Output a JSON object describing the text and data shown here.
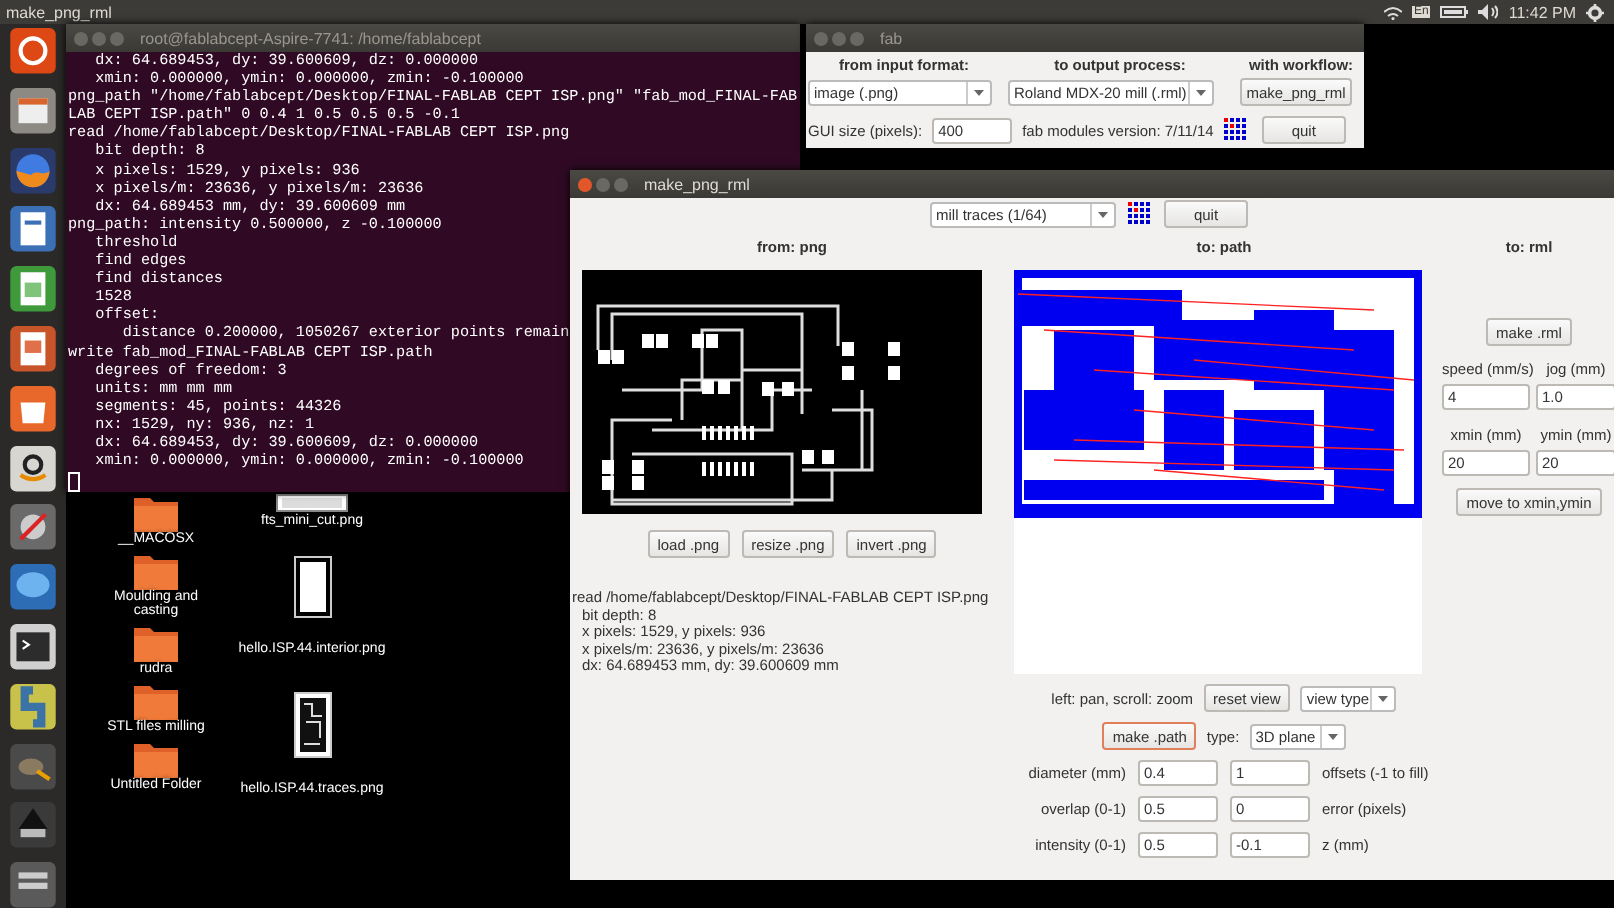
{
  "top_bar": {
    "title": "make_png_rml",
    "keyboard": "En",
    "time": "11:42 PM"
  },
  "terminal": {
    "title": "root@fablabcept-Aspire-7741: /home/fablabcept",
    "lines": [
      "   dx: 64.689453, dy: 39.600609, dz: 0.000000",
      "   xmin: 0.000000, ymin: 0.000000, zmin: -0.100000",
      "png_path \"/home/fablabcept/Desktop/FINAL-FABLAB CEPT ISP.png\" \"fab_mod_FINAL-FAB",
      "LAB CEPT ISP.path\" 0 0.4 1 0.5 0.5 0.5 -0.1",
      "read /home/fablabcept/Desktop/FINAL-FABLAB CEPT ISP.png",
      "   bit depth: 8",
      "   x pixels: 1529, y pixels: 936",
      "   x pixels/m: 23636, y pixels/m: 23636",
      "   dx: 64.689453 mm, dy: 39.600609 mm",
      "png_path: intensity 0.500000, z -0.100000",
      "   threshold",
      "   find edges",
      "   find distances",
      "   1528",
      "   offset:",
      "      distance 0.200000, 1050267 exterior points remain",
      "write fab_mod_FINAL-FABLAB CEPT ISP.path",
      "   degrees of freedom: 3",
      "   units: mm mm mm",
      "   segments: 45, points: 44326",
      "   nx: 1529, ny: 936, nz: 1",
      "   dx: 64.689453, dy: 39.600609, dz: 0.000000",
      "   xmin: 0.000000, ymin: 0.000000, zmin: -0.100000"
    ]
  },
  "desktop": {
    "folders": [
      "__MACOSX",
      "Moulding and casting",
      "rudra",
      "STL files milling",
      "Untitled Folder"
    ],
    "files": [
      {
        "label": "fts_mini_cut.png",
        "kind": "strip"
      },
      {
        "label": "hello.ISP.44.interior.png",
        "kind": "blank"
      },
      {
        "label": "hello.ISP.44.traces.png",
        "kind": "board"
      }
    ]
  },
  "fab": {
    "title": "fab",
    "headings": [
      "from input format:",
      "to output process:",
      "with workflow:"
    ],
    "input_format": "image (.png)",
    "output_process": "Roland MDX-20 mill (.rml)",
    "workflow_button": "make_png_rml",
    "gui_size_label": "GUI size (pixels):",
    "gui_size": "400",
    "version": "fab modules version: 7/11/14",
    "quit": "quit"
  },
  "make": {
    "title": "make_png_rml",
    "mode": "mill traces (1/64)",
    "quit": "quit",
    "from": {
      "heading": "from: png",
      "buttons": [
        "load .png",
        "resize .png",
        "invert .png"
      ],
      "log": [
        {
          "text": "read /home/fablabcept/Desktop/FINAL-FABLAB CEPT ISP.png",
          "children": [
            "bit depth: 8",
            "x pixels: 1529, y pixels: 936",
            "x pixels/m: 23636, y pixels/m: 23636",
            "dx: 64.689453 mm, dy: 39.600609 mm"
          ]
        }
      ]
    },
    "path": {
      "heading": "to: path",
      "view_hint": "left: pan, scroll: zoom",
      "reset": "reset view",
      "view_type": "view type",
      "make_button": {
        "label": "make .path",
        "focused": true
      },
      "type_label": "type:",
      "type": "3D plane",
      "params": [
        {
          "label": "diameter (mm)",
          "value": "0.4",
          "value2": "1",
          "label2": "offsets (-1 to fill)"
        },
        {
          "label": "overlap (0-1)",
          "value": "0.5",
          "value2": "0",
          "label2": "error (pixels)"
        },
        {
          "label": "intensity (0-1)",
          "value": "0.5",
          "value2": "-0.1",
          "label2": "z (mm)"
        }
      ]
    },
    "rml": {
      "heading": "to: rml",
      "make_button": "make .rml",
      "fields": [
        {
          "label": "speed (mm/s)",
          "value": "4"
        },
        {
          "label": "jog (mm)",
          "value": "1.0"
        },
        {
          "label": "xmin (mm)",
          "value": "20"
        },
        {
          "label": "ymin (mm)",
          "value": "20"
        }
      ],
      "move_button": "move to xmin,ymin"
    }
  }
}
